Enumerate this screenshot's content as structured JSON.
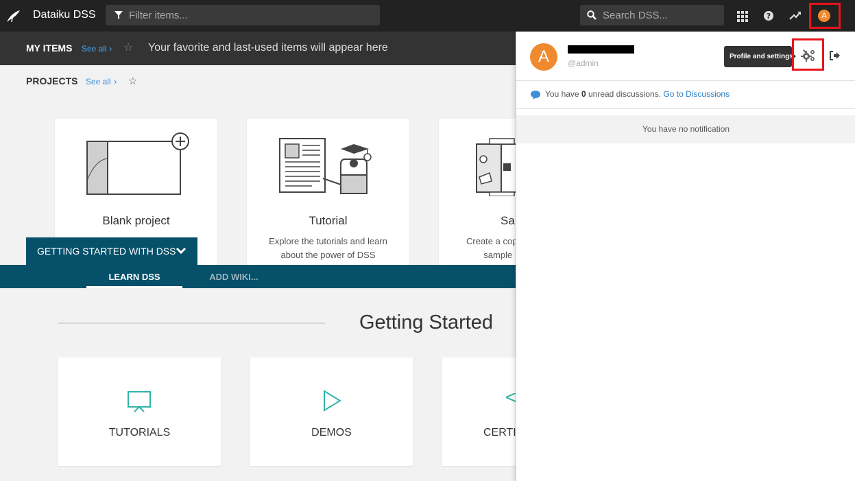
{
  "topbar": {
    "app_name": "Dataiku DSS",
    "filter_placeholder": "Filter items...",
    "search_placeholder": "Search DSS...",
    "avatar_letter": "A"
  },
  "my_items": {
    "label": "MY ITEMS",
    "see_all": "See all",
    "hint": "Your favorite and last-used items will appear here"
  },
  "projects": {
    "label": "PROJECTS",
    "see_all": "See all",
    "cards": [
      {
        "title": "Blank project",
        "desc": ""
      },
      {
        "title": "Tutorial",
        "desc": "Explore the tutorials and learn about the power of DSS"
      },
      {
        "title": "Sa",
        "desc": "Create a cop sample"
      }
    ]
  },
  "getting_started": {
    "button": "GETTING STARTED WITH DSS",
    "tabs": [
      "LEARN DSS",
      "ADD WIKI..."
    ],
    "title": "Getting Started",
    "cards": [
      "TUTORIALS",
      "DEMOS",
      "CERTI"
    ]
  },
  "panel": {
    "avatar_letter": "A",
    "username": "@admin",
    "tooltip": "Profile and settings",
    "discussions_prefix": "You have",
    "discussions_count": "0",
    "discussions_suffix": "unread discussions.",
    "discussions_link": "Go to Discussions",
    "notification": "You have no notification"
  },
  "colors": {
    "accent": "#07506a",
    "avatar": "#f08a2e",
    "highlight": "#e8141c",
    "link": "#3d8fd6",
    "teal": "#2fb5a8"
  }
}
